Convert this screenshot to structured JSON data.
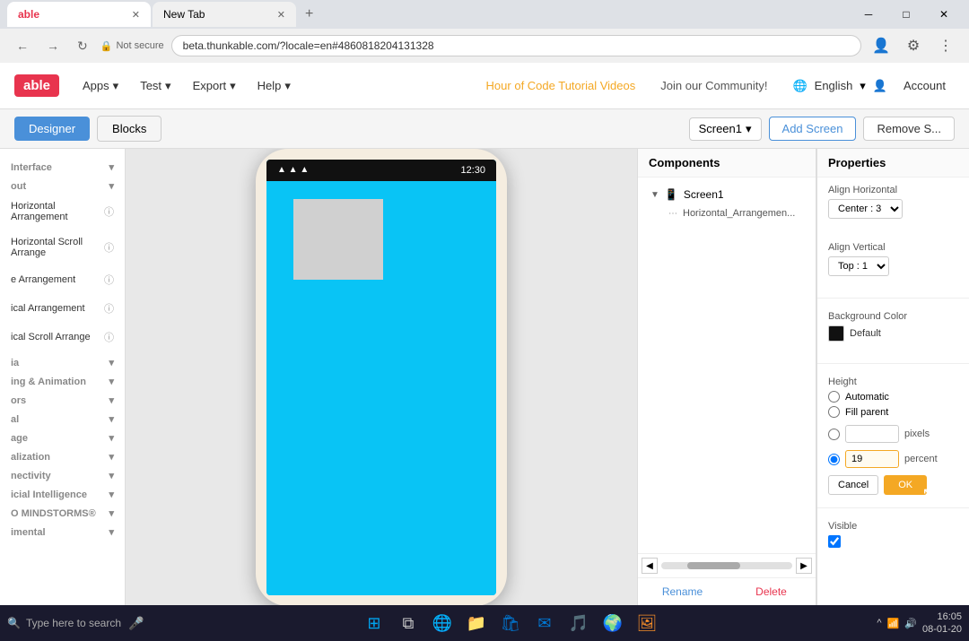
{
  "browser": {
    "tabs": [
      {
        "label": "able",
        "active": true
      },
      {
        "label": "New Tab",
        "active": false
      }
    ],
    "url": "beta.thunkable.com/?locale=en#4860818204131328",
    "secure_label": "Not secure",
    "win_controls": [
      "─",
      "□",
      "✕"
    ]
  },
  "nav": {
    "logo": "able",
    "menu_items": [
      {
        "label": "Apps",
        "has_arrow": true
      },
      {
        "label": "Test",
        "has_arrow": true
      },
      {
        "label": "Export",
        "has_arrow": true
      },
      {
        "label": "Help",
        "has_arrow": true
      }
    ],
    "promo_link": "Hour of Code Tutorial Videos",
    "community": "Join our Community!",
    "language": "English",
    "account": "Account"
  },
  "toolbar": {
    "designer_label": "Designer",
    "blocks_label": "Blocks",
    "screen_name": "Screen1",
    "add_screen": "Add Screen",
    "remove_screen": "Remove S..."
  },
  "sidebar": {
    "items": [
      {
        "label": "Interface",
        "has_arrow": true,
        "has_info": false
      },
      {
        "label": "out",
        "has_arrow": true,
        "has_info": false
      },
      {
        "label": "Horizontal Arrangement",
        "has_arrow": false,
        "has_info": true
      },
      {
        "label": "Horizontal Scroll Arrange",
        "has_arrow": false,
        "has_info": true
      },
      {
        "label": "e Arrangement",
        "has_arrow": false,
        "has_info": true
      },
      {
        "label": "ical Arrangement",
        "has_arrow": false,
        "has_info": true
      },
      {
        "label": "ical Scroll Arrange",
        "has_arrow": false,
        "has_info": true
      },
      {
        "label": "ia",
        "has_arrow": true,
        "has_info": false
      },
      {
        "label": "ing & Animation",
        "has_arrow": true,
        "has_info": false
      },
      {
        "label": "ors",
        "has_arrow": true,
        "has_info": false
      },
      {
        "label": "al",
        "has_arrow": true,
        "has_info": false
      },
      {
        "label": "age",
        "has_arrow": true,
        "has_info": false
      },
      {
        "label": "alization",
        "has_arrow": true,
        "has_info": false
      },
      {
        "label": "nectivity",
        "has_arrow": true,
        "has_info": false
      },
      {
        "label": "icial Intelligence",
        "has_arrow": true,
        "has_info": false
      },
      {
        "label": "O MINDSTORMS®",
        "has_arrow": true,
        "has_info": false
      },
      {
        "label": "imental",
        "has_arrow": true,
        "has_info": false
      }
    ]
  },
  "components": {
    "header": "Components",
    "tree": [
      {
        "label": "Screen1",
        "type": "screen",
        "level": 0
      },
      {
        "label": "Horizontal_Arrangemen...",
        "type": "component",
        "level": 1
      }
    ],
    "rename_btn": "Rename",
    "delete_btn": "Delete"
  },
  "properties": {
    "header": "Properties",
    "align_horizontal_label": "Align Horizontal",
    "align_horizontal_value": "Center : 3",
    "align_vertical_label": "Align Vertical",
    "align_vertical_value": "Top : 1",
    "background_color_label": "Background Color",
    "background_color_name": "Default",
    "height_label": "Height",
    "height_options": [
      {
        "label": "Automatic",
        "selected": false
      },
      {
        "label": "Fill parent",
        "selected": false
      },
      {
        "label": "pixels",
        "value": "",
        "selected": false
      },
      {
        "label": "percent",
        "value": "19",
        "selected": true
      }
    ],
    "pixels_label": "pixels",
    "percent_label": "percent",
    "height_value": "19",
    "cancel_label": "Cancel",
    "ok_label": "OK",
    "visible_label": "Visible",
    "visible_checked": true
  },
  "phone": {
    "status_time": "12:30",
    "screen_color": "#09c4f5"
  },
  "taskbar": {
    "search_placeholder": "Type here to search",
    "clock_time": "16:05",
    "clock_date": "08-01-20"
  }
}
